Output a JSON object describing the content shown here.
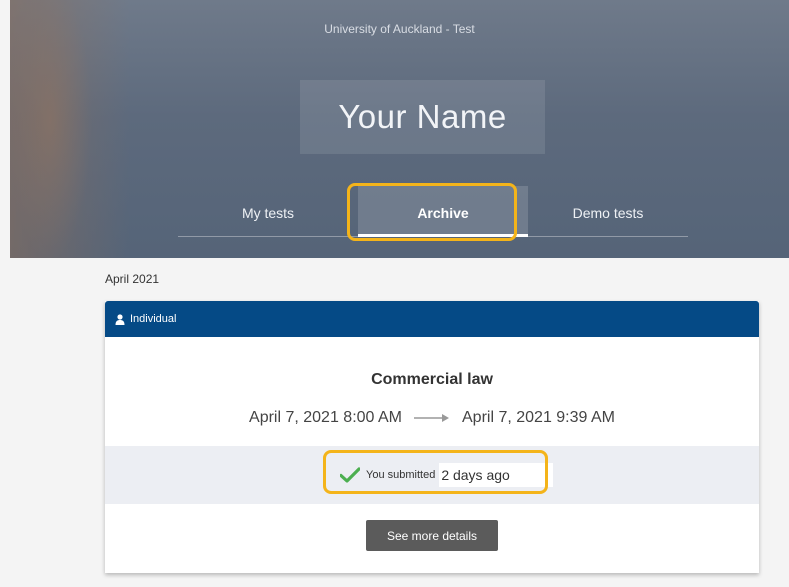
{
  "header": {
    "organization": "University of Auckland - Test",
    "user_name": "Your Name",
    "tabs": [
      {
        "label": "My tests"
      },
      {
        "label": "Archive",
        "active": true
      },
      {
        "label": "Demo tests"
      }
    ]
  },
  "archive": {
    "month": "April 2021",
    "card": {
      "type_label": "Individual",
      "type_icon": "user-icon",
      "title": "Commercial law",
      "start": "April 7, 2021 8:00 AM",
      "end": "April 7, 2021 9:39 AM",
      "status_label": "You submitted",
      "status_time": "2 days ago",
      "details_button": "See more details"
    }
  },
  "colors": {
    "card_header": "#054a86",
    "highlight": "#f4b41a",
    "success": "#4caf50",
    "button": "#5b5b5b"
  }
}
